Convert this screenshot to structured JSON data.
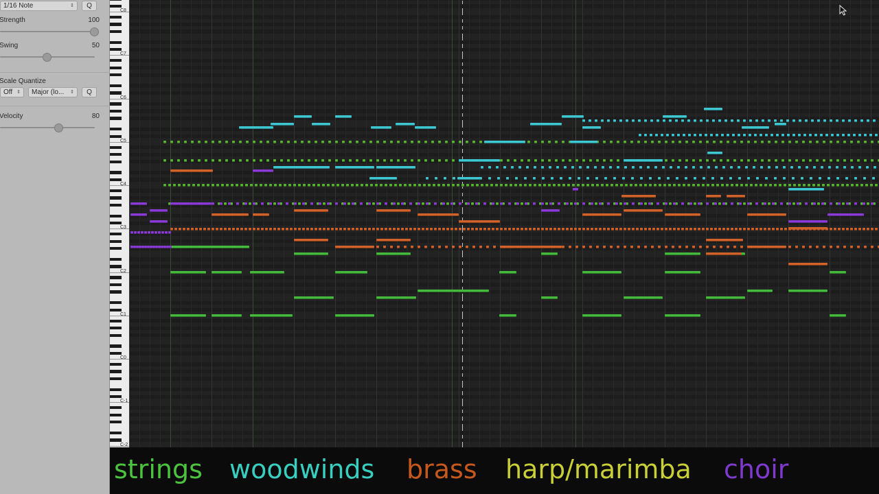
{
  "inspector": {
    "quantize_value": "1/16 Note",
    "quantize_q": "Q",
    "strength_label": "Strength",
    "strength_value": "100",
    "swing_label": "Swing",
    "swing_value": "50",
    "scale_quantize_label": "Scale Quantize",
    "scale_off": "Off",
    "scale_mode": "Major (lo...",
    "scale_q": "Q",
    "velocity_label": "Velocity",
    "velocity_value": "80",
    "strength_level": 1.0,
    "swing_level": 0.5,
    "velocity_level": 0.63
  },
  "keyboard": {
    "octave_labels": [
      "C8",
      "C7",
      "C6",
      "C5",
      "C4",
      "C3",
      "C2",
      "C1",
      "C0",
      "C-1",
      "C-2"
    ]
  },
  "legend": {
    "items": [
      {
        "label": "strings",
        "color": "#4cc33f"
      },
      {
        "label": "woodwinds",
        "color": "#38cfc0"
      },
      {
        "label": "brass",
        "color": "#c6581d"
      },
      {
        "label": "harp/marimba",
        "color": "#c9cf36"
      },
      {
        "label": "choir",
        "color": "#7f39cc"
      }
    ]
  },
  "note_colors": {
    "strings": "#44b93b",
    "woodwinds": "#3fc7d1",
    "brass": "#d0622a",
    "harp": "#58b531",
    "choir": "#8a3bd6"
  },
  "icons": {
    "cursor": "mouse-pointer-icon",
    "chevron": "updown-chevron-icon"
  }
}
